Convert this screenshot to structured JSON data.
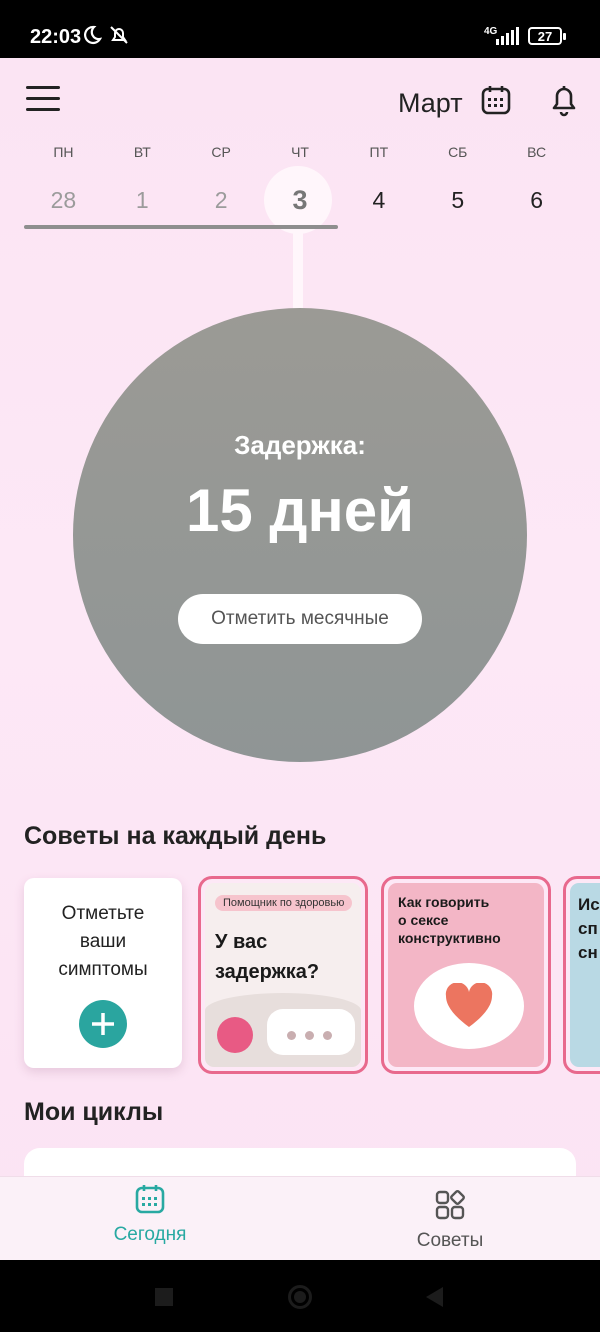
{
  "status_bar": {
    "time": "22:03",
    "network": "4G",
    "battery": "27"
  },
  "header": {
    "month": "Март"
  },
  "week": {
    "days": [
      "ПН",
      "ВТ",
      "СР",
      "ЧТ",
      "ПТ",
      "СБ",
      "ВС"
    ],
    "dates": [
      "28",
      "1",
      "2",
      "3",
      "4",
      "5",
      "6"
    ],
    "today_index": 3
  },
  "cycle_status": {
    "label": "Задержка:",
    "value": "15 дней",
    "button": "Отметить месячные"
  },
  "tips": {
    "title": "Советы на каждый день",
    "symptoms_card": {
      "line1": "Отметьте",
      "line2": "ваши",
      "line3": "симптомы"
    },
    "stories": [
      {
        "tag": "Помощник по здоровью",
        "line1": "У вас",
        "line2": "задержка?"
      },
      {
        "line1": "Как говорить",
        "line2": "о сексе",
        "line3": "конструктивно"
      },
      {
        "line1": "Ис",
        "line2": "сп",
        "line3": "сн"
      }
    ]
  },
  "cycles": {
    "title": "Мои циклы"
  },
  "bottom_nav": {
    "today": "Сегодня",
    "tips": "Советы"
  },
  "colors": {
    "accent": "#28a9a2",
    "story_border": "#e8698d",
    "circle": "#969797",
    "background": "#fde8f6"
  }
}
